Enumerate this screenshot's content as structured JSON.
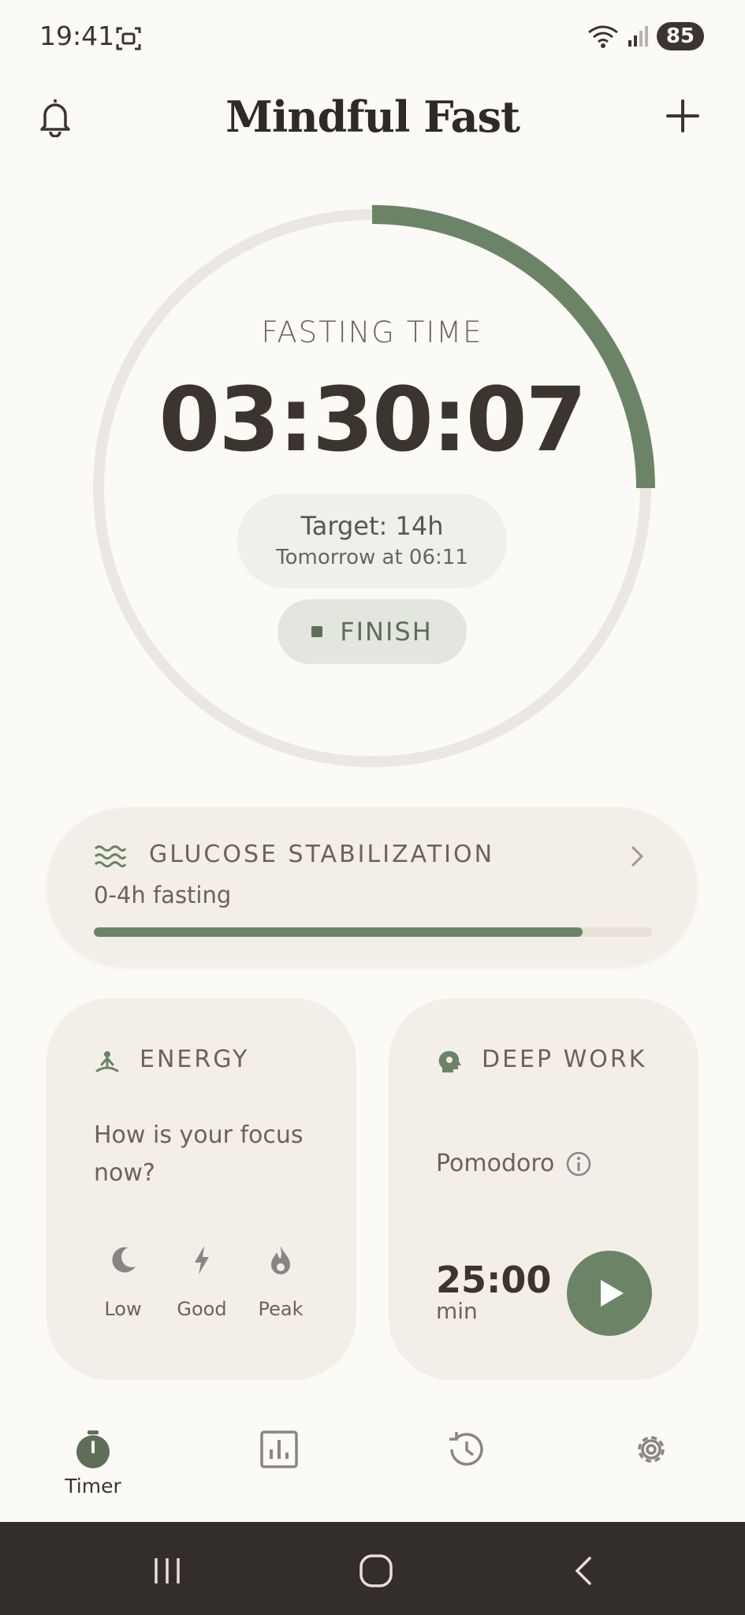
{
  "status_bar": {
    "time": "19:41",
    "battery": "85"
  },
  "header": {
    "title": "Mindful Fast"
  },
  "timer": {
    "label": "FASTING TIME",
    "elapsed": "03:30:07",
    "progress_fraction": 0.25,
    "target_text": "Target: 14h",
    "target_end_text": "Tomorrow at 06:11",
    "finish_label": "FINISH"
  },
  "stage": {
    "title": "GLUCOSE STABILIZATION",
    "subtitle": "0-4h fasting",
    "progress_fraction": 0.875
  },
  "energy": {
    "title": "ENERGY",
    "question": "How is your focus now?",
    "options": [
      {
        "label": "Low",
        "icon": "moon-icon"
      },
      {
        "label": "Good",
        "icon": "bolt-icon"
      },
      {
        "label": "Peak",
        "icon": "flame-icon"
      }
    ]
  },
  "deep_work": {
    "title": "DEEP WORK",
    "mode": "Pomodoro",
    "time": "25:00",
    "unit": "min"
  },
  "bottom_nav": {
    "items": [
      {
        "label": "Timer",
        "icon": "stopwatch-icon",
        "active": true
      },
      {
        "label": "",
        "icon": "bar-chart-icon",
        "active": false
      },
      {
        "label": "",
        "icon": "history-icon",
        "active": false
      },
      {
        "label": "",
        "icon": "gear-icon",
        "active": false
      }
    ]
  },
  "colors": {
    "accent": "#6b8466",
    "background": "#fcfaf7",
    "card": "#f3eee7",
    "text": "#3b342f"
  }
}
